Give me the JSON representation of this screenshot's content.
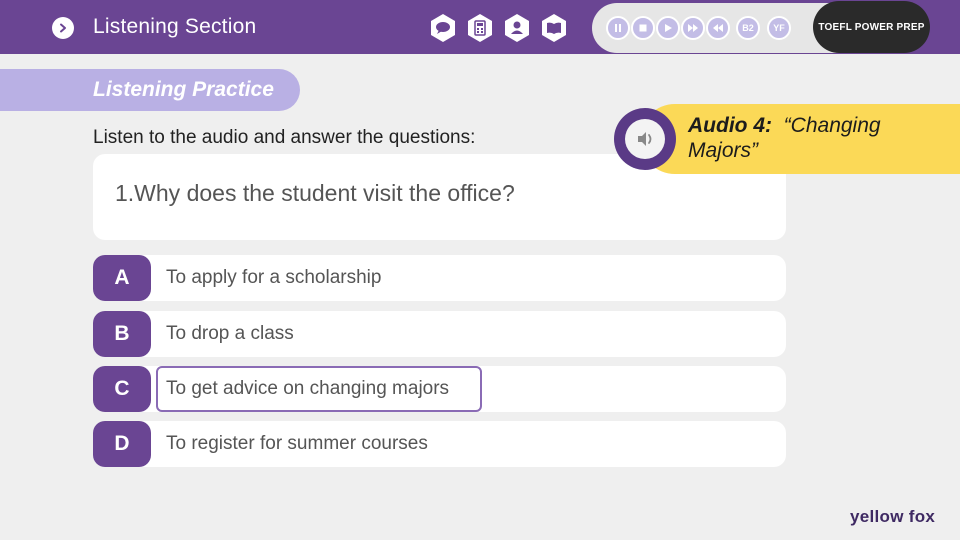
{
  "header": {
    "title": "Listening Section",
    "back_icon": "chevron-right-icon",
    "nav_icons": [
      "chat-icon",
      "calculator-icon",
      "user-icon",
      "book-icon"
    ],
    "media_controls": [
      "pause-icon",
      "stop-icon",
      "play-icon",
      "fast-forward-icon",
      "rewind-icon"
    ],
    "media_labels": {
      "level": "B2",
      "brand_short": "YF"
    },
    "brand": "TOEFL POWER PREP"
  },
  "section": {
    "title": "Listening Practice"
  },
  "instruction": "Listen to the audio and answer the questions:",
  "audio": {
    "label": "Audio 4:",
    "title": "“Changing Majors”",
    "icon": "speaker-icon"
  },
  "question": {
    "text": "1.Why does the student visit the office?"
  },
  "options": [
    {
      "letter": "A",
      "text": "To apply for a scholarship"
    },
    {
      "letter": "B",
      "text": "To drop a class"
    },
    {
      "letter": "C",
      "text": "To get advice on changing majors",
      "selected": true
    },
    {
      "letter": "D",
      "text": "To register for summer courses"
    }
  ],
  "logo": "yellow fox",
  "colors": {
    "primary": "#6a4593",
    "accent_light": "#b9b0e4",
    "audio_banner": "#fbd957",
    "background": "#efefef"
  }
}
